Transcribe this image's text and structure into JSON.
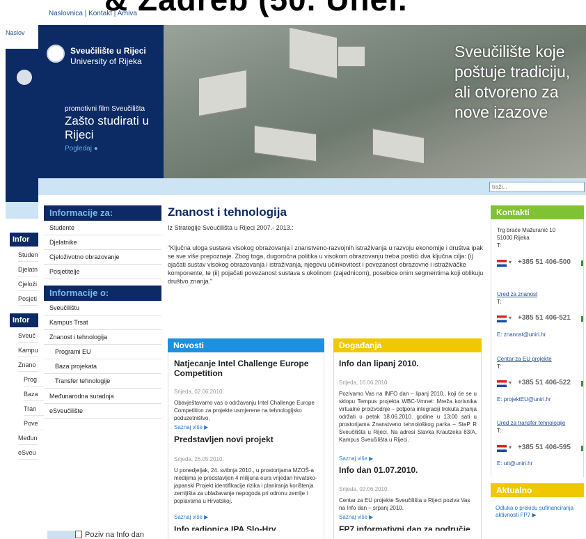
{
  "big_title": "& Zadreb (50. Unel.",
  "top_nav": [
    "Naslovnica",
    "Kontakt",
    "Arhiva"
  ],
  "ghost": {
    "nav_top": "Naslov",
    "head1": "Infor",
    "items1": [
      "Studen",
      "Djelatn",
      "Cjeloži",
      "Posjeti"
    ],
    "head2": "Infor",
    "items2": [
      "Sveuč",
      "Kampu",
      "Znano",
      "Prog",
      "Baza",
      "Tran",
      "Pove",
      "Međun",
      "eSveu"
    ]
  },
  "hero": {
    "uni_name": "Sveučilište u Rijeci",
    "uni_name_en": "University of Rijeka",
    "promo_sub": "promotivni film Sveučilišta",
    "promo_title": "Zašto studirati u Rijeci",
    "promo_link": "Pogledaj ●",
    "slogan": "Sveučilište koje poštuje tradiciju, ali otvoreno za nove izazove"
  },
  "search": {
    "placeholder": "traži..."
  },
  "sidebar": {
    "head1": "Informacije za:",
    "items1": [
      "Studente",
      "Djelatnike",
      "Cjeloživotno obrazovanje",
      "Posjetitelje"
    ],
    "head2": "Informacije o:",
    "items2": [
      "Sveučilištu",
      "Kampus Trsat",
      "Znanost i tehnologija",
      "Programi EU",
      "Baza projekata",
      "Transfer tehnologije",
      "Međunarodna suradnja",
      "eSveučilište"
    ]
  },
  "main": {
    "title": "Znanost i tehnologija",
    "subtitle": "Iz Strategije Sveučilišta u Rijeci 2007.- 2013.:",
    "quote": "\"Ključna uloga sustava visokog obrazovanja i znanstveno-razvojnih istraživanja u razvoju ekonomije i društva ipak se sve više prepoznaje.  Zbog toga, dugoročna politika u visokom obrazovanju treba postići dva ključna cilja: (i) ojačati sustav visokog obrazovanja i istraživanja, njegovu učinkovitost i povezanost obrazovne i istraživačke komponente, te (ii) pojačati povezanost sustava s okolinom (zajednicom), posebice onim segmentima koji oblikuju društvo znanja.\""
  },
  "novosti": {
    "head": "Novosti",
    "items": [
      {
        "title": "Natjecanje Intel Challenge Europe Competition",
        "date": "Srijeda, 02.06.2010.",
        "text": "Obavještavamo vas o održavanju Intel Challenge Europe Competition za projekte usmjerene na tehnologijsko poduzetništvo.",
        "more": "Saznaj više ▶"
      },
      {
        "title": "Predstavljen novi projekt",
        "date": "Srijeda, 26.05.2010.",
        "text": "U ponedjeljak, 24. svibnja 2010., u prostorijama MZOŠ-a medijima je predstavljen 4 milijuna eura vrijedan hrvatsko-japanski Projekt identifikacije rizika i planiranja korištenja zemljišta za ublažavanje nepogoda pri odronu zemlje i poplavama u Hrvatskoj.",
        "more": "Saznaj više ▶"
      },
      {
        "title": "Info radionica IPA Slo-Hrv",
        "date": "",
        "text": "",
        "more": ""
      }
    ]
  },
  "dogadanja": {
    "head": "Događanja",
    "items": [
      {
        "title": "Info dan lipanj 2010.",
        "date": "Srijeda, 16.06.2010.",
        "text": "Pozivamo Vas na INFO dan – lipanj 2010., koji će se u sklopu Tempus projekta WBC-Vmnet: Mreža korisnika virtualne proizvodnje – potpora integraciji trokuta znanja održati u petak 18.06.2010. godine u 13:00 sati u prostorijama Znanstveno tehnološkog parka – StеP R Sveučilišta u Rijeci. Na adresi Slavka Krautzeka 83/A, Kampus Sveučilišta u Rijeci.",
        "more": "Saznaj više ▶"
      },
      {
        "title": "Info dan 01.07.2010.",
        "date": "Srijeda, 02.06.2010.",
        "text": "Centar za EU projekte Sveučilišta u Rijeci poziva Vas na Info dan – srpanj 2010.",
        "more": "Saznaj više ▶"
      },
      {
        "title": "FP7 informativni dan za područje",
        "date": "",
        "text": "",
        "more": ""
      }
    ]
  },
  "kontakti": {
    "head": "Kontakti",
    "address1": "Trg braće Mažuranić 10",
    "address2": "51000 Rijeka",
    "t_label": "T:",
    "phones": [
      "+385 51 406-500",
      "+385 51 406-521",
      "+385 51 406-522",
      "+385 51 406-595"
    ],
    "offices": [
      {
        "name": "Ured za znanost",
        "email": "E: znanost@uniri.hr"
      },
      {
        "name": "Centar za EU projekte",
        "email": "E: projektEU@uniri.hr"
      },
      {
        "name": "Ured za transfer tehnologije",
        "email": "E: utt@uniri.hr"
      }
    ]
  },
  "aktualno": {
    "head": "Aktualno",
    "link": "Odluka o prekidu sufinanciranja aktivnosti FP7 ▶"
  },
  "bottom": {
    "text": "Poziv na Info dan"
  },
  "colors": {
    "navy": "#0c2a63",
    "novosti_blue": "#1e90e0",
    "dogadanja_yellow": "#f0c800",
    "kontakti_green": "#7fc234",
    "link_blue": "#2b7bd0"
  }
}
